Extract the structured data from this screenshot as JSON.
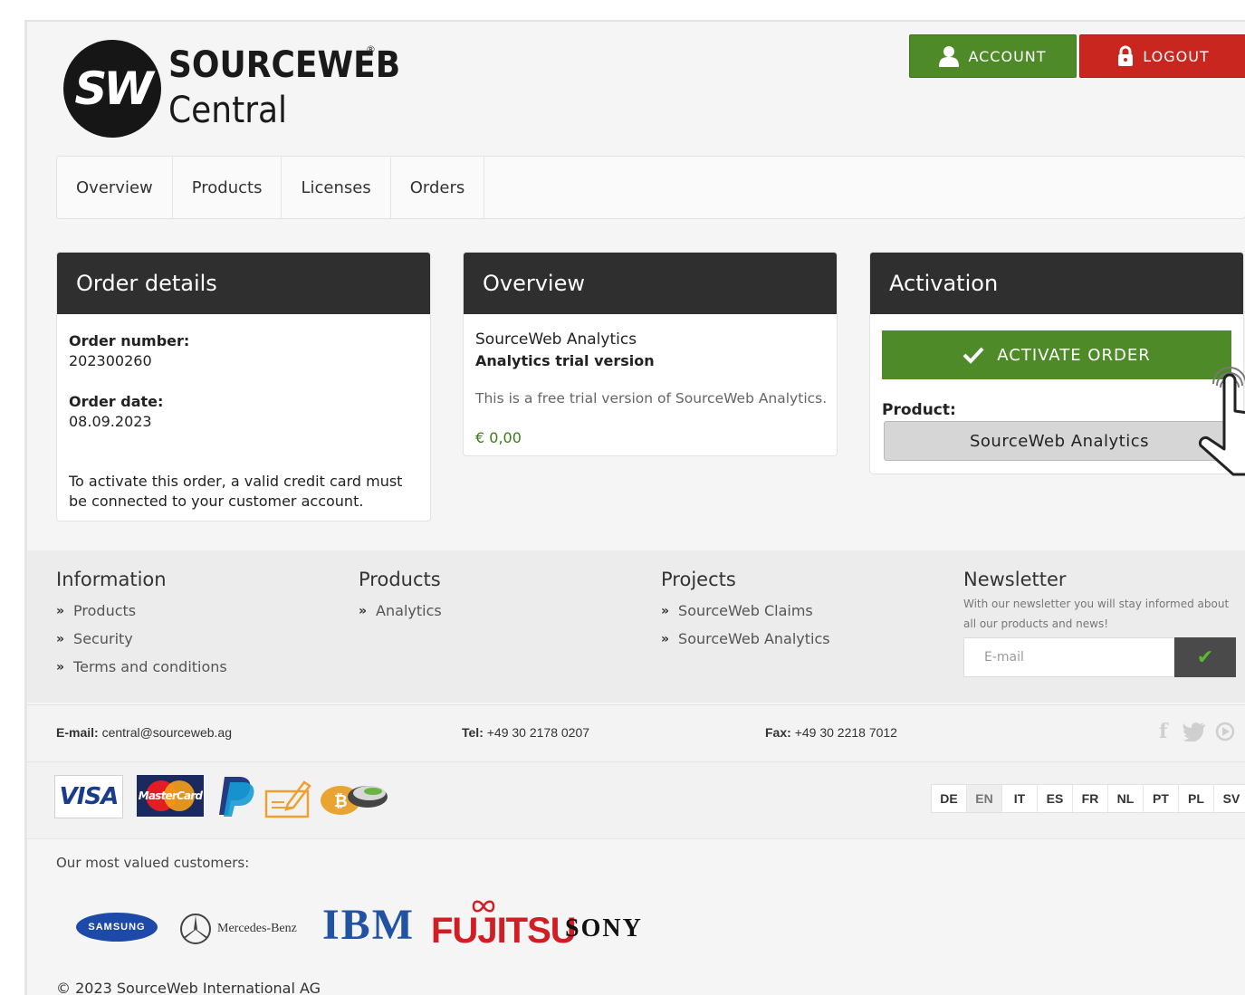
{
  "brand": {
    "logo_mark": "SW",
    "name": "SOURCEWEB",
    "registered": "®",
    "subtitle": "Central"
  },
  "header": {
    "account_label": "ACCOUNT",
    "logout_label": "LOGOUT",
    "account_icon": "user-icon",
    "logout_icon": "lock-icon"
  },
  "nav": {
    "items": [
      "Overview",
      "Products",
      "Licenses",
      "Orders"
    ]
  },
  "order_details": {
    "title": "Order details",
    "number_label": "Order number:",
    "number_value": "202300260",
    "date_label": "Order date:",
    "date_value": "08.09.2023",
    "note": "To activate this order, a valid credit card must be connected to your customer account."
  },
  "overview": {
    "title": "Overview",
    "product_name": "SourceWeb Analytics",
    "product_variant": "Analytics trial version",
    "description": "This is a free trial version of SourceWeb Analytics.",
    "price": "€ 0,00"
  },
  "activation": {
    "title": "Activation",
    "activate_label": "ACTIVATE ORDER",
    "product_label": "Product:",
    "product_value": "SourceWeb Analytics"
  },
  "footer": {
    "information": {
      "title": "Information",
      "links": [
        "Products",
        "Security",
        "Terms and conditions"
      ]
    },
    "products": {
      "title": "Products",
      "links": [
        "Analytics"
      ]
    },
    "projects": {
      "title": "Projects",
      "links": [
        "SourceWeb Claims",
        "SourceWeb Analytics"
      ]
    },
    "newsletter": {
      "title": "Newsletter",
      "text": "With our newsletter you will stay informed about all our products and news!",
      "placeholder": "E-mail"
    },
    "contact": {
      "email_label": "E-mail:",
      "email_value": "central@sourceweb.ag",
      "tel_label": "Tel:",
      "tel_value": "+49 30 2178 0207",
      "fax_label": "Fax:",
      "fax_value": "+49 30 2218 7012"
    },
    "payment_logos": [
      "VISA",
      "MasterCard",
      "PayPal",
      "Invoice",
      "Bitcoin"
    ],
    "languages": [
      "DE",
      "EN",
      "IT",
      "ES",
      "FR",
      "NL",
      "PT",
      "PL",
      "SV"
    ],
    "active_language": "EN",
    "customers_label": "Our most valued customers:",
    "customers": [
      "SAMSUNG",
      "Mercedes-Benz",
      "IBM",
      "FUJITSU",
      "SONY"
    ],
    "copyright": "© 2023 SourceWeb International AG"
  },
  "colors": {
    "green": "#4e8a27",
    "red": "#c9261f",
    "dark_header": "#2f2f2f",
    "price": "#3d7a1a"
  }
}
